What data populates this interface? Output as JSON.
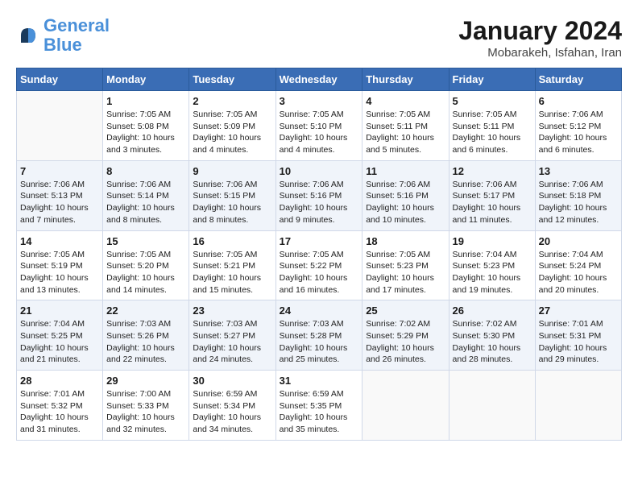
{
  "logo": {
    "line1": "General",
    "line2": "Blue"
  },
  "title": "January 2024",
  "location": "Mobarakeh, Isfahan, Iran",
  "weekdays": [
    "Sunday",
    "Monday",
    "Tuesday",
    "Wednesday",
    "Thursday",
    "Friday",
    "Saturday"
  ],
  "weeks": [
    [
      {
        "day": "",
        "info": ""
      },
      {
        "day": "1",
        "info": "Sunrise: 7:05 AM\nSunset: 5:08 PM\nDaylight: 10 hours\nand 3 minutes."
      },
      {
        "day": "2",
        "info": "Sunrise: 7:05 AM\nSunset: 5:09 PM\nDaylight: 10 hours\nand 4 minutes."
      },
      {
        "day": "3",
        "info": "Sunrise: 7:05 AM\nSunset: 5:10 PM\nDaylight: 10 hours\nand 4 minutes."
      },
      {
        "day": "4",
        "info": "Sunrise: 7:05 AM\nSunset: 5:11 PM\nDaylight: 10 hours\nand 5 minutes."
      },
      {
        "day": "5",
        "info": "Sunrise: 7:05 AM\nSunset: 5:11 PM\nDaylight: 10 hours\nand 6 minutes."
      },
      {
        "day": "6",
        "info": "Sunrise: 7:06 AM\nSunset: 5:12 PM\nDaylight: 10 hours\nand 6 minutes."
      }
    ],
    [
      {
        "day": "7",
        "info": "Sunrise: 7:06 AM\nSunset: 5:13 PM\nDaylight: 10 hours\nand 7 minutes."
      },
      {
        "day": "8",
        "info": "Sunrise: 7:06 AM\nSunset: 5:14 PM\nDaylight: 10 hours\nand 8 minutes."
      },
      {
        "day": "9",
        "info": "Sunrise: 7:06 AM\nSunset: 5:15 PM\nDaylight: 10 hours\nand 8 minutes."
      },
      {
        "day": "10",
        "info": "Sunrise: 7:06 AM\nSunset: 5:16 PM\nDaylight: 10 hours\nand 9 minutes."
      },
      {
        "day": "11",
        "info": "Sunrise: 7:06 AM\nSunset: 5:16 PM\nDaylight: 10 hours\nand 10 minutes."
      },
      {
        "day": "12",
        "info": "Sunrise: 7:06 AM\nSunset: 5:17 PM\nDaylight: 10 hours\nand 11 minutes."
      },
      {
        "day": "13",
        "info": "Sunrise: 7:06 AM\nSunset: 5:18 PM\nDaylight: 10 hours\nand 12 minutes."
      }
    ],
    [
      {
        "day": "14",
        "info": "Sunrise: 7:05 AM\nSunset: 5:19 PM\nDaylight: 10 hours\nand 13 minutes."
      },
      {
        "day": "15",
        "info": "Sunrise: 7:05 AM\nSunset: 5:20 PM\nDaylight: 10 hours\nand 14 minutes."
      },
      {
        "day": "16",
        "info": "Sunrise: 7:05 AM\nSunset: 5:21 PM\nDaylight: 10 hours\nand 15 minutes."
      },
      {
        "day": "17",
        "info": "Sunrise: 7:05 AM\nSunset: 5:22 PM\nDaylight: 10 hours\nand 16 minutes."
      },
      {
        "day": "18",
        "info": "Sunrise: 7:05 AM\nSunset: 5:23 PM\nDaylight: 10 hours\nand 17 minutes."
      },
      {
        "day": "19",
        "info": "Sunrise: 7:04 AM\nSunset: 5:23 PM\nDaylight: 10 hours\nand 19 minutes."
      },
      {
        "day": "20",
        "info": "Sunrise: 7:04 AM\nSunset: 5:24 PM\nDaylight: 10 hours\nand 20 minutes."
      }
    ],
    [
      {
        "day": "21",
        "info": "Sunrise: 7:04 AM\nSunset: 5:25 PM\nDaylight: 10 hours\nand 21 minutes."
      },
      {
        "day": "22",
        "info": "Sunrise: 7:03 AM\nSunset: 5:26 PM\nDaylight: 10 hours\nand 22 minutes."
      },
      {
        "day": "23",
        "info": "Sunrise: 7:03 AM\nSunset: 5:27 PM\nDaylight: 10 hours\nand 24 minutes."
      },
      {
        "day": "24",
        "info": "Sunrise: 7:03 AM\nSunset: 5:28 PM\nDaylight: 10 hours\nand 25 minutes."
      },
      {
        "day": "25",
        "info": "Sunrise: 7:02 AM\nSunset: 5:29 PM\nDaylight: 10 hours\nand 26 minutes."
      },
      {
        "day": "26",
        "info": "Sunrise: 7:02 AM\nSunset: 5:30 PM\nDaylight: 10 hours\nand 28 minutes."
      },
      {
        "day": "27",
        "info": "Sunrise: 7:01 AM\nSunset: 5:31 PM\nDaylight: 10 hours\nand 29 minutes."
      }
    ],
    [
      {
        "day": "28",
        "info": "Sunrise: 7:01 AM\nSunset: 5:32 PM\nDaylight: 10 hours\nand 31 minutes."
      },
      {
        "day": "29",
        "info": "Sunrise: 7:00 AM\nSunset: 5:33 PM\nDaylight: 10 hours\nand 32 minutes."
      },
      {
        "day": "30",
        "info": "Sunrise: 6:59 AM\nSunset: 5:34 PM\nDaylight: 10 hours\nand 34 minutes."
      },
      {
        "day": "31",
        "info": "Sunrise: 6:59 AM\nSunset: 5:35 PM\nDaylight: 10 hours\nand 35 minutes."
      },
      {
        "day": "",
        "info": ""
      },
      {
        "day": "",
        "info": ""
      },
      {
        "day": "",
        "info": ""
      }
    ]
  ]
}
